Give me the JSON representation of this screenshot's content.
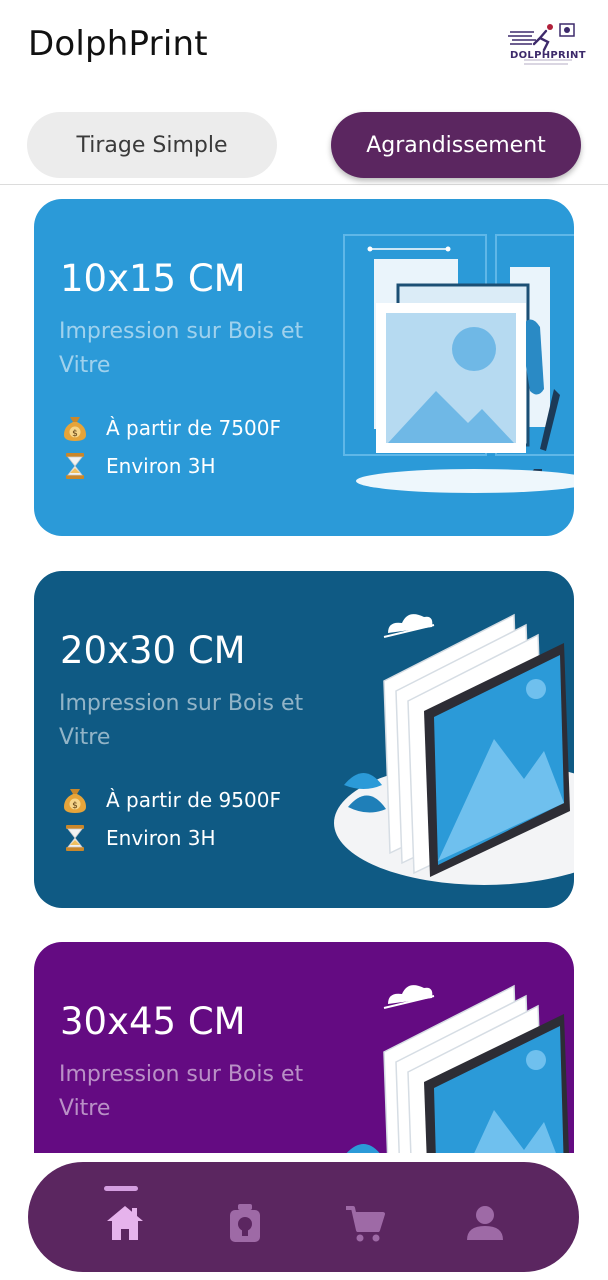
{
  "app": {
    "title": "DolphPrint",
    "logo_text": "DOLPHPRINT"
  },
  "tabs": [
    {
      "label": "Tirage Simple",
      "active": false
    },
    {
      "label": "Agrandissement",
      "active": true
    }
  ],
  "cards": [
    {
      "size": "10x15 CM",
      "description": "Impression sur Bois et Vitre",
      "price": "À partir de 7500F",
      "duration": "Environ 3H",
      "color": "#2b9ad8"
    },
    {
      "size": "20x30 CM",
      "description": "Impression sur Bois et Vitre",
      "price": "À partir de 9500F",
      "duration": "Environ 3H",
      "color": "#0f5a84"
    },
    {
      "size": "30x45 CM",
      "description": "Impression sur Bois et Vitre",
      "price": "",
      "duration": "",
      "color": "#640b82"
    }
  ],
  "bottom_nav": {
    "items": [
      {
        "icon": "home-icon",
        "active": true
      },
      {
        "icon": "frame-icon",
        "active": false
      },
      {
        "icon": "cart-icon",
        "active": false
      },
      {
        "icon": "profile-icon",
        "active": false
      }
    ],
    "background": "#5b2660",
    "active_color": "#e6b3ec",
    "inactive_color": "#9e6aa6"
  }
}
